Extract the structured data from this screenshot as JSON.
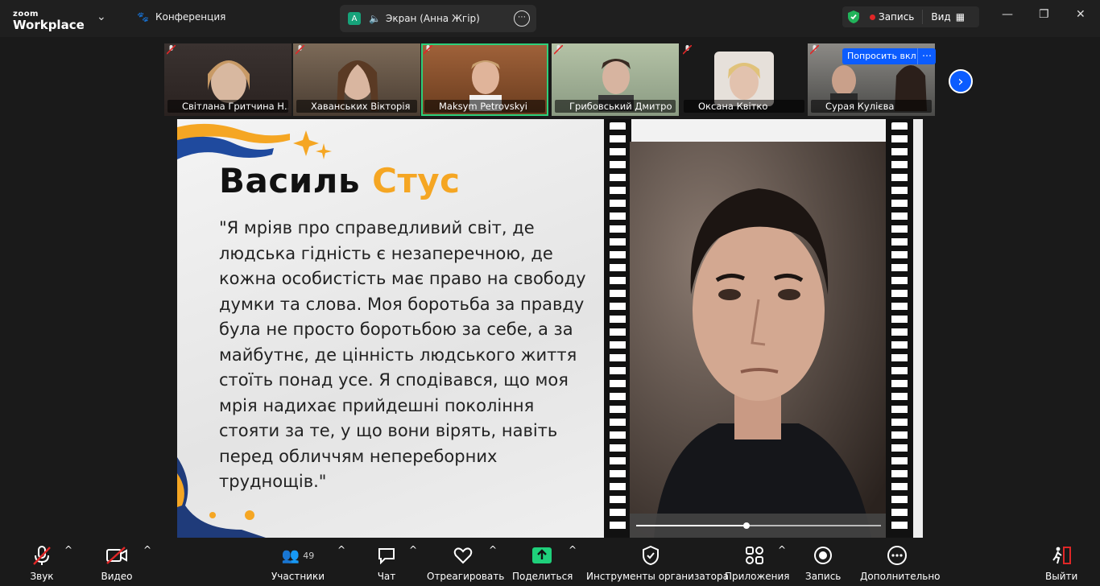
{
  "app": {
    "brand_small": "zoom",
    "brand_large": "Workplace",
    "conference_label": "Конференция"
  },
  "share_tab": {
    "badge": "A",
    "label": "Экран (Анна Жгір)"
  },
  "recording": {
    "label": "Запись",
    "view_label": "Вид"
  },
  "participants_strip": [
    {
      "name": "Світлана Гритчина Н...",
      "muted": true
    },
    {
      "name": "Хаванських Вікторія",
      "muted": true
    },
    {
      "name": "Maksym Petrovskyi",
      "muted": true,
      "active": true
    },
    {
      "name": "Грибовський Дмитро",
      "muted": true
    },
    {
      "name": "Оксана Квітко",
      "muted": true
    },
    {
      "name": "Сурая Кулієва",
      "muted": true
    }
  ],
  "ask_button": "Попросить вкл",
  "slide": {
    "title_first": "Василь",
    "title_second": "Стус",
    "quote": "\"Я мріяв про справедливий світ, де людська гідність є незаперечною, де кожна особистість має право на свободу думки та слова. Моя боротьба за правду була не просто боротьбою за себе, а за майбутнє, де цінність людського життя стоїть понад усе. Я сподівався, що моя мрія надихає прийдешні покоління стояти за те, у що вони вірять, навіть перед обличчям непереборних труднощів.\"",
    "video_progress": 0.45
  },
  "toolbar": {
    "audio": "Звук",
    "video": "Видео",
    "participants": "Участники",
    "participants_count": "49",
    "chat": "Чат",
    "react": "Отреагировать",
    "share": "Поделиться",
    "host_tools": "Инструменты организатора",
    "apps": "Приложения",
    "record": "Запись",
    "more": "Дополнительно",
    "leave": "Выйти"
  },
  "colors": {
    "accent": "#f5a623",
    "brand_blue": "#0b5cff",
    "active_green": "#2dd07b",
    "rec_red": "#e02727"
  }
}
